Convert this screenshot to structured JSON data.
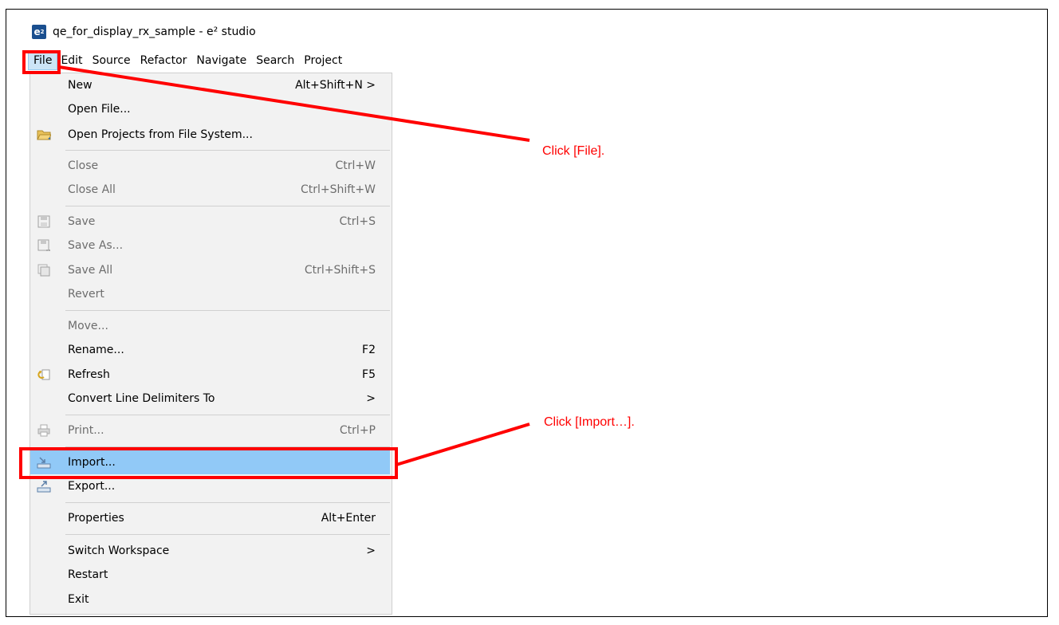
{
  "window": {
    "logo_text": "e",
    "logo_sup": "2",
    "title": "qe_for_display_rx_sample - e² studio"
  },
  "menubar": [
    "File",
    "Edit",
    "Source",
    "Refactor",
    "Navigate",
    "Search",
    "Project"
  ],
  "file_menu": {
    "new": {
      "label": "New",
      "shortcut": "Alt+Shift+N >"
    },
    "open_file": {
      "label": "Open File..."
    },
    "open_projects": {
      "label": "Open Projects from File System..."
    },
    "close": {
      "label": "Close",
      "shortcut": "Ctrl+W"
    },
    "close_all": {
      "label": "Close All",
      "shortcut": "Ctrl+Shift+W"
    },
    "save": {
      "label": "Save",
      "shortcut": "Ctrl+S"
    },
    "save_as": {
      "label": "Save As..."
    },
    "save_all": {
      "label": "Save All",
      "shortcut": "Ctrl+Shift+S"
    },
    "revert": {
      "label": "Revert"
    },
    "move": {
      "label": "Move..."
    },
    "rename": {
      "label": "Rename...",
      "shortcut": "F2"
    },
    "refresh": {
      "label": "Refresh",
      "shortcut": "F5"
    },
    "convert": {
      "label": "Convert Line Delimiters To",
      "shortcut": ">"
    },
    "print": {
      "label": "Print...",
      "shortcut": "Ctrl+P"
    },
    "import": {
      "label": "Import..."
    },
    "export": {
      "label": "Export..."
    },
    "properties": {
      "label": "Properties",
      "shortcut": "Alt+Enter"
    },
    "switch_workspace": {
      "label": "Switch Workspace",
      "shortcut": ">"
    },
    "restart": {
      "label": "Restart"
    },
    "exit": {
      "label": "Exit"
    }
  },
  "annotations": {
    "file": "Click [File].",
    "import": "Click [Import…]."
  },
  "colors": {
    "highlight": "#91c9f7",
    "annotation": "#ff0000",
    "menu_bg": "#f2f2f2"
  }
}
